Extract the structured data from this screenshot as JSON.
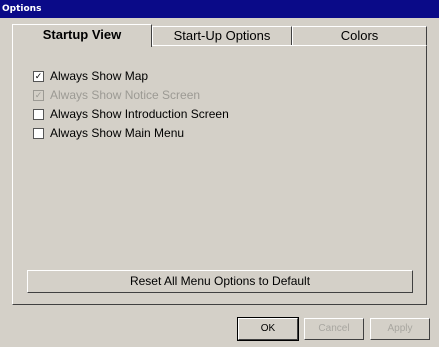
{
  "window": {
    "title": "Options"
  },
  "tabs": [
    {
      "label": "Startup View",
      "active": true
    },
    {
      "label": "Start-Up Options",
      "active": false
    },
    {
      "label": "Colors",
      "active": false
    }
  ],
  "options": [
    {
      "label": "Always Show Map",
      "checked": true,
      "disabled": false,
      "mark": "✓"
    },
    {
      "label": "Always Show Notice Screen",
      "checked": true,
      "disabled": true,
      "mark": "✓"
    },
    {
      "label": "Always Show Introduction Screen",
      "checked": false,
      "disabled": false,
      "mark": ""
    },
    {
      "label": "Always Show Main Menu",
      "checked": false,
      "disabled": false,
      "mark": ""
    }
  ],
  "reset_button": {
    "label": "Reset All Menu Options to Default"
  },
  "buttons": {
    "ok": "OK",
    "cancel": "Cancel",
    "apply": "Apply"
  },
  "colors": {
    "titlebar": "#0a0a88",
    "face": "#d4d0c8",
    "disabled_text": "#9c9a94"
  }
}
